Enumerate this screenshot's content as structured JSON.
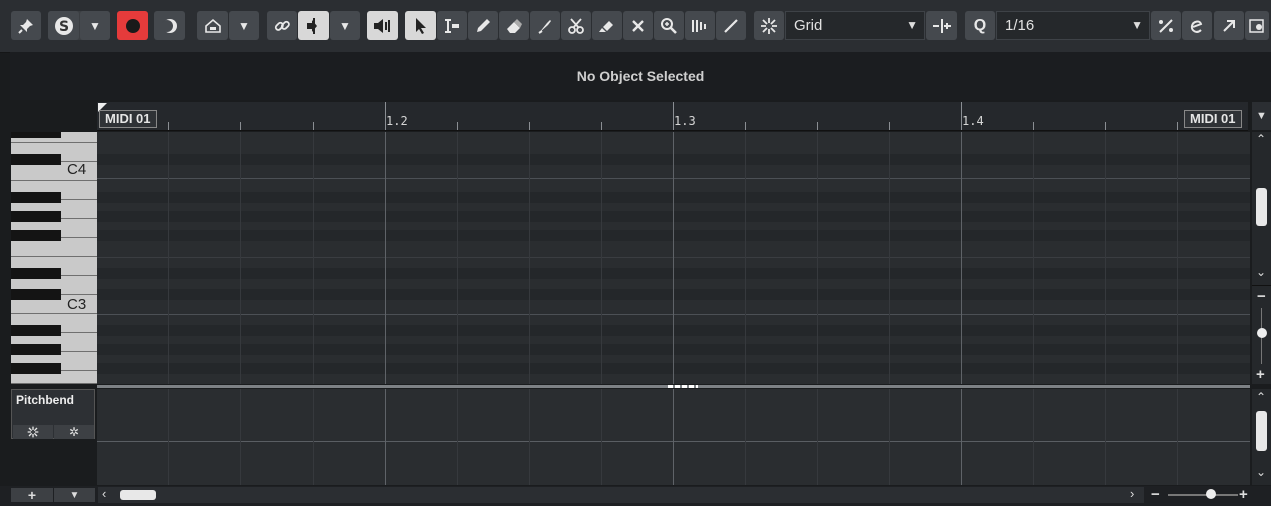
{
  "toolbar": {
    "grid_type": "Grid",
    "quantize": "1/16",
    "quantize_label": "Q"
  },
  "infoline": {
    "text": "No Object Selected"
  },
  "ruler": {
    "ticks": [
      "1.2",
      "1.3",
      "1.4"
    ],
    "part_name_left": "MIDI 01",
    "part_name_right": "MIDI 01"
  },
  "keyboard": {
    "labels": [
      "C4",
      "C3"
    ]
  },
  "controller_lane": {
    "name": "Pitchbend"
  },
  "colors": {
    "accent_record": "#e53b3b",
    "background": "#1a1c1e",
    "grid_bg": "#2a2d30"
  }
}
